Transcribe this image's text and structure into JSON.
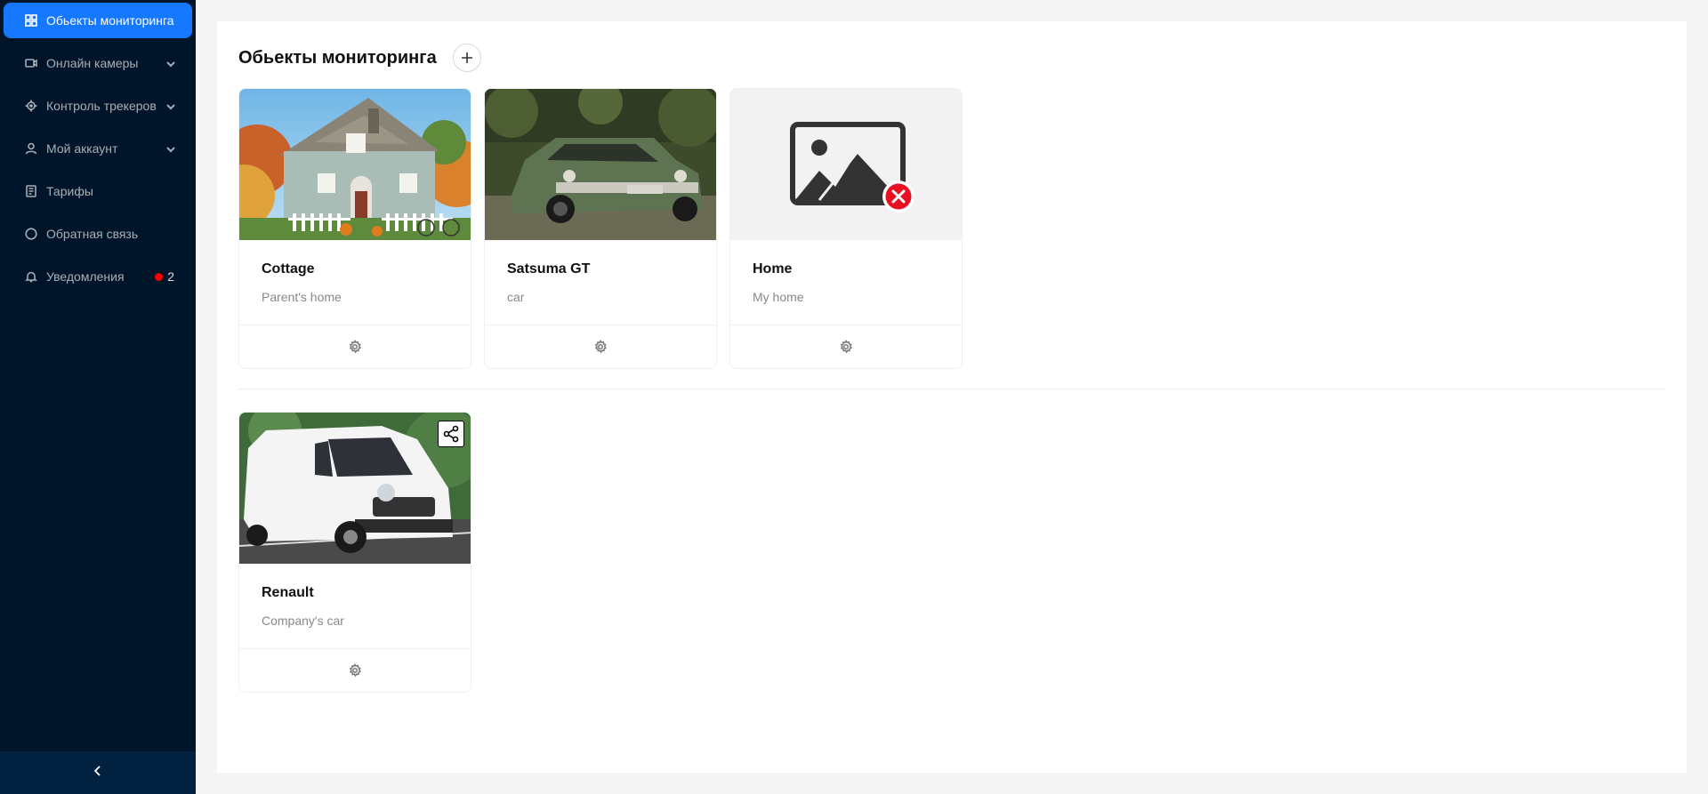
{
  "sidebar": {
    "items": [
      {
        "label": "Обьекты мониторинга",
        "icon": "grid-icon",
        "active": true
      },
      {
        "label": "Онлайн камеры",
        "icon": "camera-icon",
        "expandable": true
      },
      {
        "label": "Контроль трекеров",
        "icon": "location-icon",
        "expandable": true
      },
      {
        "label": "Мой аккаунт",
        "icon": "user-icon",
        "expandable": true
      },
      {
        "label": "Тарифы",
        "icon": "receipt-icon"
      },
      {
        "label": "Обратная связь",
        "icon": "message-icon"
      },
      {
        "label": "Уведомления",
        "icon": "bell-icon",
        "badge_count": "2"
      }
    ],
    "collapse_icon": "chevron-left-icon"
  },
  "header": {
    "title": "Обьекты мониторинга",
    "add_icon": "plus-icon"
  },
  "cards": [
    {
      "title": "Cottage",
      "description": "Parent's home",
      "cover": "house-photo"
    },
    {
      "title": "Satsuma GT",
      "description": "car",
      "cover": "car-photo"
    },
    {
      "title": "Home",
      "description": "My home",
      "cover": "image-error-placeholder"
    },
    {
      "title": "Renault",
      "description": "Company's car",
      "cover": "van-photo",
      "shared": true
    }
  ],
  "colors": {
    "sidebar_bg": "#001529",
    "active_item": "#1677ff",
    "badge": "#ff0000",
    "error": "#e81123"
  }
}
